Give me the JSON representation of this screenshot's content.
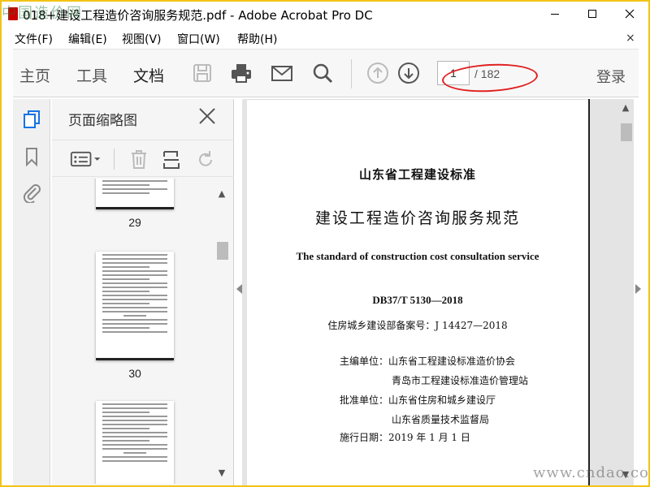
{
  "window": {
    "title": "018+建设工程造价咨询服务规范.pdf - Adobe Acrobat Pro DC"
  },
  "watermark": {
    "top_left": "中国造价网",
    "bottom_right": "www.cndao.com"
  },
  "menu": {
    "file": "文件(F)",
    "edit": "编辑(E)",
    "view": "视图(V)",
    "window": "窗口(W)",
    "help": "帮助(H)",
    "close": "×"
  },
  "toolbar": {
    "tabs": [
      "主页",
      "工具",
      "文档"
    ],
    "active_tab": "文档",
    "page_current": "1",
    "page_total": "/ 182",
    "login": "登录"
  },
  "thumbnail_panel": {
    "title": "页面缩略图",
    "pages": [
      "29",
      "30"
    ]
  },
  "document": {
    "org_title": "山东省工程建设标准",
    "main_title": "建设工程造价咨询服务规范",
    "english_title": "The standard of construction cost consultation service",
    "standard_no": "DB37/T 5130—2018",
    "record_no": "住房城乡建设部备案号：J 14427—2018",
    "editor_label": "主编单位：山东省工程建设标准造价协会",
    "editor_2": "青岛市工程建设标准造价管理站",
    "approver_label": "批准单位：山东省住房和城乡建设厅",
    "approver_2": "山东省质量技术监督局",
    "effective_date": "施行日期：2019 年 1 月 1 日"
  },
  "colors": {
    "frame": "#f3c316",
    "highlight_circle": "#e02020",
    "active_rail_icon": "#1473e6"
  }
}
